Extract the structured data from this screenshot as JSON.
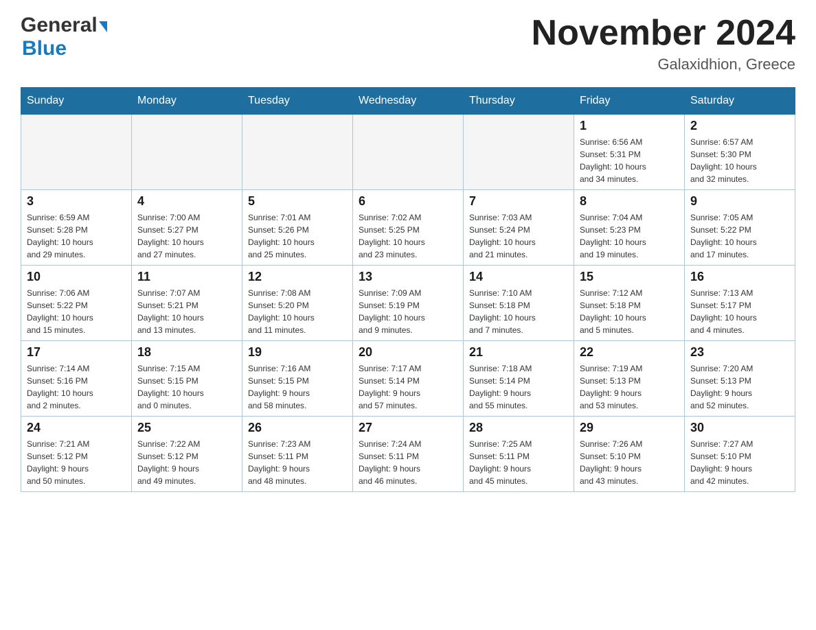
{
  "header": {
    "logo_general": "General",
    "logo_blue": "Blue",
    "month_title": "November 2024",
    "location": "Galaxidhion, Greece"
  },
  "weekdays": [
    "Sunday",
    "Monday",
    "Tuesday",
    "Wednesday",
    "Thursday",
    "Friday",
    "Saturday"
  ],
  "weeks": [
    [
      {
        "day": "",
        "info": ""
      },
      {
        "day": "",
        "info": ""
      },
      {
        "day": "",
        "info": ""
      },
      {
        "day": "",
        "info": ""
      },
      {
        "day": "",
        "info": ""
      },
      {
        "day": "1",
        "info": "Sunrise: 6:56 AM\nSunset: 5:31 PM\nDaylight: 10 hours\nand 34 minutes."
      },
      {
        "day": "2",
        "info": "Sunrise: 6:57 AM\nSunset: 5:30 PM\nDaylight: 10 hours\nand 32 minutes."
      }
    ],
    [
      {
        "day": "3",
        "info": "Sunrise: 6:59 AM\nSunset: 5:28 PM\nDaylight: 10 hours\nand 29 minutes."
      },
      {
        "day": "4",
        "info": "Sunrise: 7:00 AM\nSunset: 5:27 PM\nDaylight: 10 hours\nand 27 minutes."
      },
      {
        "day": "5",
        "info": "Sunrise: 7:01 AM\nSunset: 5:26 PM\nDaylight: 10 hours\nand 25 minutes."
      },
      {
        "day": "6",
        "info": "Sunrise: 7:02 AM\nSunset: 5:25 PM\nDaylight: 10 hours\nand 23 minutes."
      },
      {
        "day": "7",
        "info": "Sunrise: 7:03 AM\nSunset: 5:24 PM\nDaylight: 10 hours\nand 21 minutes."
      },
      {
        "day": "8",
        "info": "Sunrise: 7:04 AM\nSunset: 5:23 PM\nDaylight: 10 hours\nand 19 minutes."
      },
      {
        "day": "9",
        "info": "Sunrise: 7:05 AM\nSunset: 5:22 PM\nDaylight: 10 hours\nand 17 minutes."
      }
    ],
    [
      {
        "day": "10",
        "info": "Sunrise: 7:06 AM\nSunset: 5:22 PM\nDaylight: 10 hours\nand 15 minutes."
      },
      {
        "day": "11",
        "info": "Sunrise: 7:07 AM\nSunset: 5:21 PM\nDaylight: 10 hours\nand 13 minutes."
      },
      {
        "day": "12",
        "info": "Sunrise: 7:08 AM\nSunset: 5:20 PM\nDaylight: 10 hours\nand 11 minutes."
      },
      {
        "day": "13",
        "info": "Sunrise: 7:09 AM\nSunset: 5:19 PM\nDaylight: 10 hours\nand 9 minutes."
      },
      {
        "day": "14",
        "info": "Sunrise: 7:10 AM\nSunset: 5:18 PM\nDaylight: 10 hours\nand 7 minutes."
      },
      {
        "day": "15",
        "info": "Sunrise: 7:12 AM\nSunset: 5:18 PM\nDaylight: 10 hours\nand 5 minutes."
      },
      {
        "day": "16",
        "info": "Sunrise: 7:13 AM\nSunset: 5:17 PM\nDaylight: 10 hours\nand 4 minutes."
      }
    ],
    [
      {
        "day": "17",
        "info": "Sunrise: 7:14 AM\nSunset: 5:16 PM\nDaylight: 10 hours\nand 2 minutes."
      },
      {
        "day": "18",
        "info": "Sunrise: 7:15 AM\nSunset: 5:15 PM\nDaylight: 10 hours\nand 0 minutes."
      },
      {
        "day": "19",
        "info": "Sunrise: 7:16 AM\nSunset: 5:15 PM\nDaylight: 9 hours\nand 58 minutes."
      },
      {
        "day": "20",
        "info": "Sunrise: 7:17 AM\nSunset: 5:14 PM\nDaylight: 9 hours\nand 57 minutes."
      },
      {
        "day": "21",
        "info": "Sunrise: 7:18 AM\nSunset: 5:14 PM\nDaylight: 9 hours\nand 55 minutes."
      },
      {
        "day": "22",
        "info": "Sunrise: 7:19 AM\nSunset: 5:13 PM\nDaylight: 9 hours\nand 53 minutes."
      },
      {
        "day": "23",
        "info": "Sunrise: 7:20 AM\nSunset: 5:13 PM\nDaylight: 9 hours\nand 52 minutes."
      }
    ],
    [
      {
        "day": "24",
        "info": "Sunrise: 7:21 AM\nSunset: 5:12 PM\nDaylight: 9 hours\nand 50 minutes."
      },
      {
        "day": "25",
        "info": "Sunrise: 7:22 AM\nSunset: 5:12 PM\nDaylight: 9 hours\nand 49 minutes."
      },
      {
        "day": "26",
        "info": "Sunrise: 7:23 AM\nSunset: 5:11 PM\nDaylight: 9 hours\nand 48 minutes."
      },
      {
        "day": "27",
        "info": "Sunrise: 7:24 AM\nSunset: 5:11 PM\nDaylight: 9 hours\nand 46 minutes."
      },
      {
        "day": "28",
        "info": "Sunrise: 7:25 AM\nSunset: 5:11 PM\nDaylight: 9 hours\nand 45 minutes."
      },
      {
        "day": "29",
        "info": "Sunrise: 7:26 AM\nSunset: 5:10 PM\nDaylight: 9 hours\nand 43 minutes."
      },
      {
        "day": "30",
        "info": "Sunrise: 7:27 AM\nSunset: 5:10 PM\nDaylight: 9 hours\nand 42 minutes."
      }
    ]
  ]
}
